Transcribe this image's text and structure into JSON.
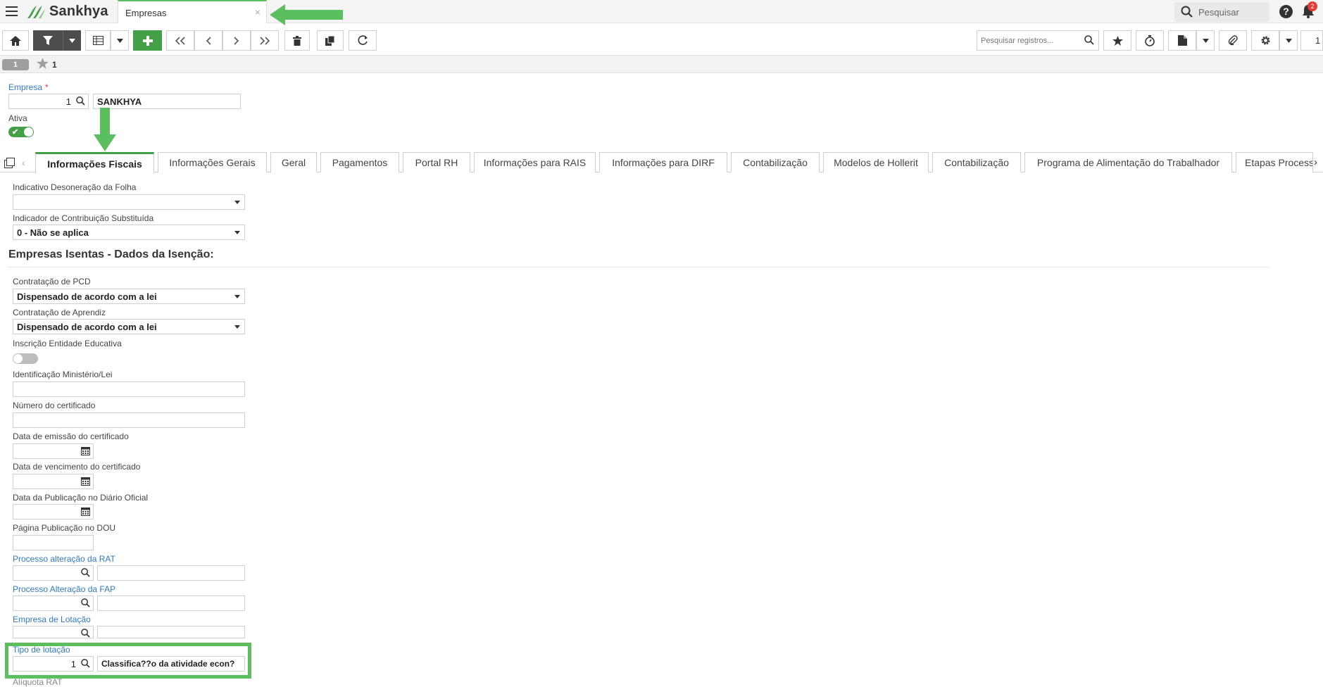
{
  "header": {
    "brand": "Sankhya",
    "app_tab": "Empresas",
    "app_tab_close": "×",
    "search_label": "Pesquisar",
    "help": "?",
    "notifications": "2"
  },
  "toolbar": {
    "search_placeholder": "Pesquisar registros...",
    "page": "1"
  },
  "record_bar": {
    "index": "1",
    "favorites_count": "1"
  },
  "form": {
    "empresa_label": "Empresa",
    "empresa_required": "*",
    "empresa_code": "1",
    "empresa_name": "SANKHYA",
    "ativa_label": "Ativa"
  },
  "tabs": [
    "Informações Fiscais",
    "Informações Gerais",
    "Geral",
    "Pagamentos",
    "Portal RH",
    "Informações para RAIS",
    "Informações para DIRF",
    "Contabilização",
    "Modelos de Hollerit",
    "Contabilização",
    "Programa de Alimentação do Trabalhador",
    "Etapas Process"
  ],
  "fiscal": {
    "desoneracao_label": "Indicativo Desoneração da Folha",
    "desoneracao_value": "",
    "contrib_label": "Indicador de Contribuição Substituída",
    "contrib_value": "0 - Não se aplica",
    "section_title": "Empresas Isentas - Dados da Isenção:",
    "pcd_label": "Contratação de PCD",
    "pcd_value": "Dispensado de acordo com a lei",
    "aprendiz_label": "Contratação de Aprendiz",
    "aprendiz_value": "Dispensado de acordo com a lei",
    "inscricao_label": "Inscrição Entidade Educativa",
    "identificacao_label": "Identificação Ministério/Lei",
    "numero_label": "Número do certificado",
    "emissao_label": "Data de emissão do certificado",
    "vencimento_label": "Data de vencimento do certificado",
    "publicacao_label": "Data da Publicação no Diário Oficial",
    "pagina_label": "Página Publicação no DOU",
    "rat_label": "Processo alteração da RAT",
    "fap_label": "Processo Alteração da FAP",
    "lotacao_label": "Empresa de Lotação",
    "tipo_lotacao_label": "Tipo de lotação",
    "tipo_lotacao_code": "1",
    "tipo_lotacao_desc": "Classifica??o da atividade econ?",
    "aliquota_label": "Alíquota RAT"
  },
  "colors": {
    "accent": "#43a047",
    "link": "#2f79c7",
    "highlight": "#5cbf5f"
  }
}
